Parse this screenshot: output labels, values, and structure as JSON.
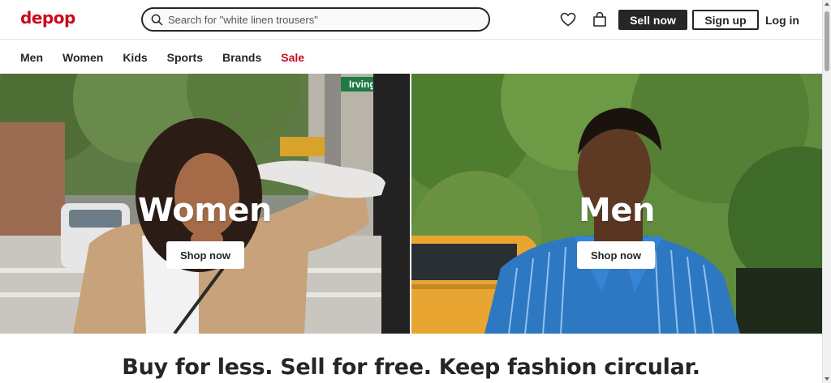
{
  "brand": {
    "logo_text": "depop",
    "accent_color": "#cc0a1d"
  },
  "search": {
    "placeholder": "Search for \"white linen trousers\"",
    "icon": "search-icon"
  },
  "header_actions": {
    "wishlist_icon": "heart-icon",
    "bag_icon": "shopping-bag-icon",
    "sell_label": "Sell now",
    "signup_label": "Sign up",
    "login_label": "Log in"
  },
  "nav": {
    "items": [
      {
        "label": "Men"
      },
      {
        "label": "Women"
      },
      {
        "label": "Kids"
      },
      {
        "label": "Sports"
      },
      {
        "label": "Brands"
      },
      {
        "label": "Sale",
        "color": "#cc0a1d"
      }
    ]
  },
  "hero": {
    "left": {
      "title": "Women",
      "cta": "Shop now",
      "street_sign": "Irving Pl"
    },
    "right": {
      "title": "Men",
      "cta": "Shop now"
    }
  },
  "tagline": "Buy for less. Sell for free. Keep fashion circular."
}
